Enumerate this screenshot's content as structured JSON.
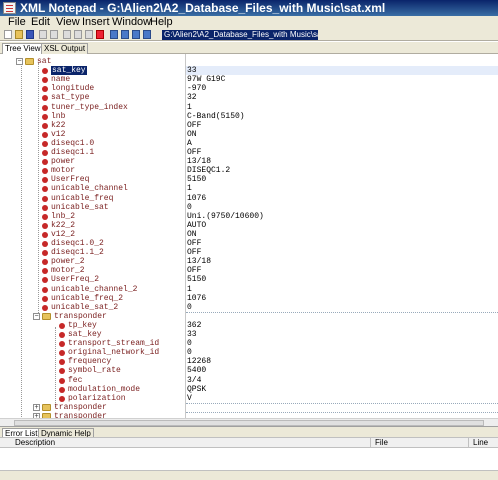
{
  "window": {
    "title": "XML Notepad - G:\\Alien2\\A2_Database_Files_with Music\\sat.xml"
  },
  "menu": [
    "File",
    "Edit",
    "View",
    "Insert",
    "Window",
    "Help"
  ],
  "toolbar": {
    "path_value": "G:\\Alien2\\A2_Database_Files_with Music\\sat.xml"
  },
  "tabs": [
    "Tree View",
    "XSL Output"
  ],
  "tree": {
    "root": "sat",
    "attributes": [
      {
        "name": "sat_key",
        "value": "33"
      },
      {
        "name": "name",
        "value": "97W G19C"
      },
      {
        "name": "longitude",
        "value": "-970"
      },
      {
        "name": "sat_type",
        "value": "32"
      },
      {
        "name": "tuner_type_index",
        "value": "1"
      },
      {
        "name": "lnb",
        "value": "C-Band(5150)"
      },
      {
        "name": "k22",
        "value": "OFF"
      },
      {
        "name": "v12",
        "value": "ON"
      },
      {
        "name": "diseqc1.0",
        "value": "A"
      },
      {
        "name": "diseqc1.1",
        "value": "OFF"
      },
      {
        "name": "power",
        "value": "13/18"
      },
      {
        "name": "motor",
        "value": "DISEQC1.2"
      },
      {
        "name": "UserFreq",
        "value": "5150"
      },
      {
        "name": "unicable_channel",
        "value": "1"
      },
      {
        "name": "unicable_freq",
        "value": "1076"
      },
      {
        "name": "unicable_sat",
        "value": "0"
      },
      {
        "name": "lnb_2",
        "value": "Uni.(9750/10600)"
      },
      {
        "name": "k22_2",
        "value": "AUTO"
      },
      {
        "name": "v12_2",
        "value": "ON"
      },
      {
        "name": "diseqc1.0_2",
        "value": "OFF"
      },
      {
        "name": "diseqc1.1_2",
        "value": "OFF"
      },
      {
        "name": "power_2",
        "value": "13/18"
      },
      {
        "name": "motor_2",
        "value": "OFF"
      },
      {
        "name": "UserFreq_2",
        "value": "5150"
      },
      {
        "name": "unicable_channel_2",
        "value": "1"
      },
      {
        "name": "unicable_freq_2",
        "value": "1076"
      },
      {
        "name": "unicable_sat_2",
        "value": "0"
      }
    ],
    "transponder_label": "transponder",
    "transponder_children": [
      {
        "name": "tp_key",
        "value": "362"
      },
      {
        "name": "sat_key",
        "value": "33"
      },
      {
        "name": "transport_stream_id",
        "value": "0"
      },
      {
        "name": "original_network_id",
        "value": "0"
      },
      {
        "name": "frequency",
        "value": "12268"
      },
      {
        "name": "symbol_rate",
        "value": "5400"
      },
      {
        "name": "fec",
        "value": "3/4"
      },
      {
        "name": "modulation_mode",
        "value": "QPSK"
      },
      {
        "name": "polarization",
        "value": "V"
      }
    ],
    "collapsed_nodes": [
      "transponder",
      "transponder"
    ]
  },
  "bottom_tabs": [
    "Error List",
    "Dynamic Help"
  ],
  "error_list": {
    "columns": [
      "Description",
      "File",
      "Line"
    ]
  }
}
